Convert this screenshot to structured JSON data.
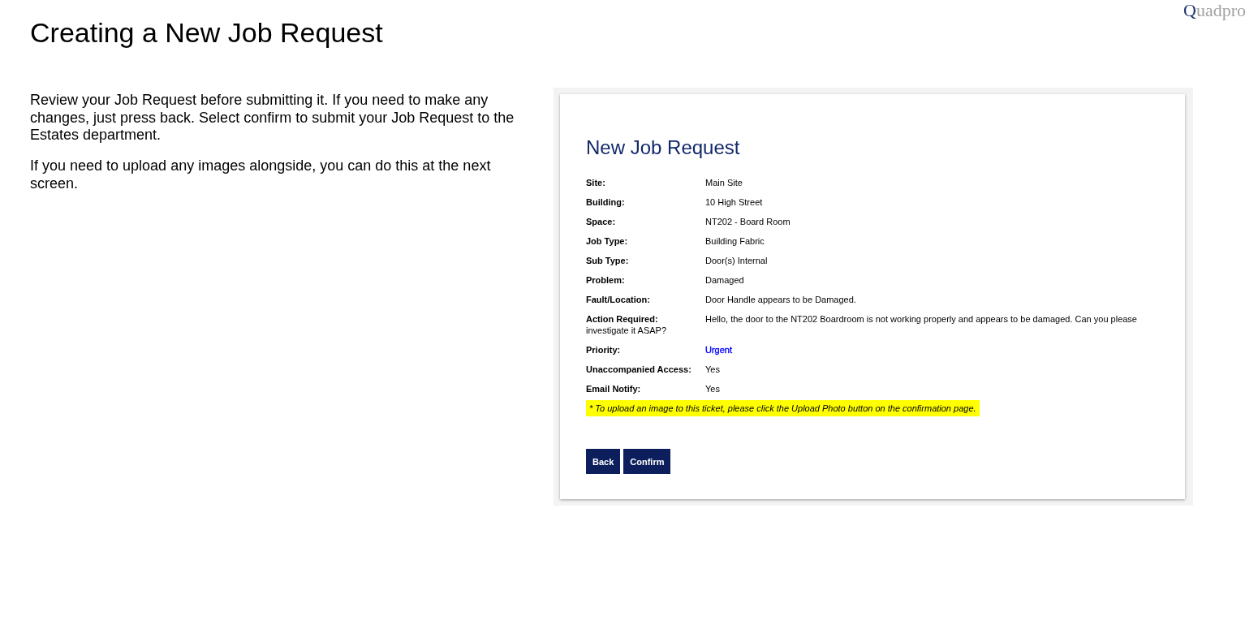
{
  "slide": {
    "title": "Creating a New Job Request",
    "logo": "Quadpro",
    "paragraphs": [
      "Review your Job Request before submitting it. If you need to make any changes, just press back. Select confirm to submit your Job Request to the Estates department.",
      "If you need to upload any images alongside, you can do this at the next screen."
    ]
  },
  "screenshot": {
    "heading": "New Job Request",
    "fields": [
      {
        "label": "Site:",
        "value": "Main Site"
      },
      {
        "label": "Building:",
        "value": "10 High Street"
      },
      {
        "label": "Space:",
        "value": "NT202 - Board Room"
      },
      {
        "label": "Job Type:",
        "value": "Building Fabric"
      },
      {
        "label": "Sub Type:",
        "value": "Door(s) Internal"
      },
      {
        "label": "Problem:",
        "value": "Damaged"
      },
      {
        "label": "Fault/Location:",
        "value": "Door Handle appears to be Damaged."
      },
      {
        "label": "Action Required:",
        "value": "Hello, the door to the NT202 Boardroom is not working properly and appears to be damaged. Can you please investigate it ASAP?"
      },
      {
        "label": "Priority:",
        "value": "Urgent",
        "color": "#0000ff"
      },
      {
        "label": "Unaccompanied Access:",
        "value": "Yes"
      },
      {
        "label": "Email Notify:",
        "value": "Yes"
      }
    ],
    "notice": "* To upload an image to this ticket, please click the Upload Photo button on the confirmation page.",
    "buttons": [
      "Back",
      "Confirm"
    ]
  }
}
